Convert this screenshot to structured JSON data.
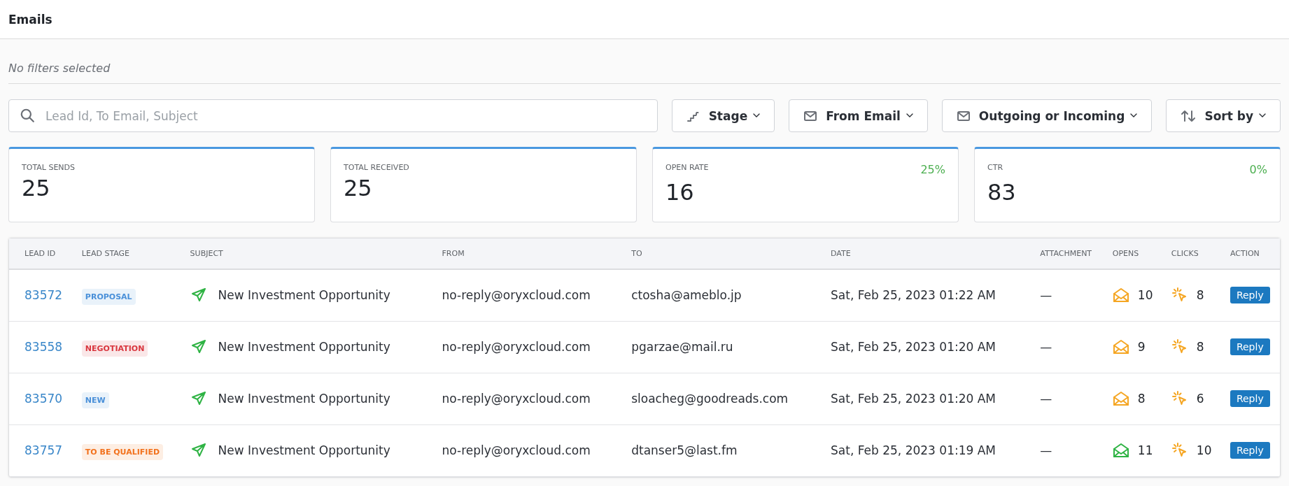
{
  "header": {
    "title": "Emails"
  },
  "filters_summary": "No filters selected",
  "search": {
    "placeholder": "Lead Id, To Email, Subject"
  },
  "filter_buttons": [
    {
      "label": "Stage",
      "kind": "stage"
    },
    {
      "label": "From Email",
      "kind": "mail"
    },
    {
      "label": "Outgoing or Incoming",
      "kind": "mail"
    },
    {
      "label": "Sort by",
      "kind": "sort"
    }
  ],
  "stats": [
    {
      "label": "TOTAL SENDS",
      "value": "25"
    },
    {
      "label": "TOTAL RECEIVED",
      "value": "25"
    },
    {
      "label": "OPEN RATE",
      "value": "16",
      "rate": "25%"
    },
    {
      "label": "CTR",
      "value": "83",
      "rate": "0%"
    }
  ],
  "table": {
    "columns": [
      "LEAD ID",
      "LEAD STAGE",
      "SUBJECT",
      "FROM",
      "TO",
      "DATE",
      "ATTACHMENT",
      "OPENS",
      "CLICKS",
      "ACTION"
    ],
    "rows": [
      {
        "lead_id": "83572",
        "stage": {
          "label": "PROPOSAL",
          "color": "#4a90d9"
        },
        "subject": "New Investment Opportunity",
        "from": "no-reply@oryxcloud.com",
        "to": "ctosha@ameblo.jp",
        "date": "Sat, Feb 25, 2023 01:22 AM",
        "attachment": "—",
        "opens": {
          "count": "10",
          "color": "#f5a623"
        },
        "clicks": "8",
        "action": "Reply"
      },
      {
        "lead_id": "83558",
        "stage": {
          "label": "NEGOTIATION",
          "color": "#d9363e"
        },
        "subject": "New Investment Opportunity",
        "from": "no-reply@oryxcloud.com",
        "to": "pgarzae@mail.ru",
        "date": "Sat, Feb 25, 2023 01:20 AM",
        "attachment": "—",
        "opens": {
          "count": "9",
          "color": "#f5a623"
        },
        "clicks": "8",
        "action": "Reply"
      },
      {
        "lead_id": "83570",
        "stage": {
          "label": "NEW",
          "color": "#4a90d9"
        },
        "subject": "New Investment Opportunity",
        "from": "no-reply@oryxcloud.com",
        "to": "sloacheg@goodreads.com",
        "date": "Sat, Feb 25, 2023 01:20 AM",
        "attachment": "—",
        "opens": {
          "count": "8",
          "color": "#f5a623"
        },
        "clicks": "6",
        "action": "Reply"
      },
      {
        "lead_id": "83757",
        "stage": {
          "label": "TO BE QUALIFIED",
          "color": "#f2711c"
        },
        "subject": "New Investment Opportunity",
        "from": "no-reply@oryxcloud.com",
        "to": "dtanser5@last.fm",
        "date": "Sat, Feb 25, 2023 01:19 AM",
        "attachment": "—",
        "opens": {
          "count": "11",
          "color": "#2fb344"
        },
        "clicks": "10",
        "action": "Reply"
      }
    ]
  }
}
